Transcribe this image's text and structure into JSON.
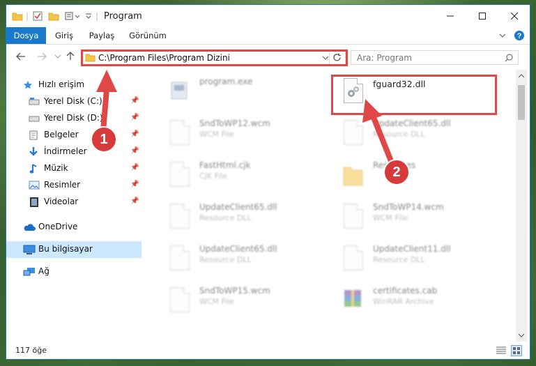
{
  "window": {
    "title": "Program"
  },
  "ribbon": {
    "tabs": [
      "Dosya",
      "Giriş",
      "Paylaş",
      "Görünüm"
    ]
  },
  "address": {
    "path": "C:\\Program Files\\Program Dizini"
  },
  "search": {
    "placeholder": "Ara: Program"
  },
  "nav": {
    "items": [
      {
        "label": "Hızlı erişim",
        "icon": "star-icon"
      },
      {
        "label": "Yerel Disk (C:)",
        "icon": "drive-icon"
      },
      {
        "label": "Yerel Disk (D:)",
        "icon": "drive-icon"
      },
      {
        "label": "Belgeler",
        "icon": "documents-icon"
      },
      {
        "label": "İndirmeler",
        "icon": "download-icon"
      },
      {
        "label": "Müzik",
        "icon": "music-icon"
      },
      {
        "label": "Resimler",
        "icon": "pictures-icon"
      },
      {
        "label": "Videolar",
        "icon": "video-icon"
      },
      {
        "label": "OneDrive",
        "icon": "cloud-icon"
      },
      {
        "label": "Bu bilgisayar",
        "icon": "computer-icon"
      },
      {
        "label": "Ağ",
        "icon": "network-icon"
      }
    ]
  },
  "files": [
    {
      "name": "program.exe",
      "type": "",
      "icon": "exe-icon"
    },
    {
      "name": "fguard32.dll",
      "type": "",
      "icon": "dll-icon"
    },
    {
      "name": "SndToWP12.wcm",
      "type": "WCM File",
      "icon": "file-icon"
    },
    {
      "name": "UpdateClient65.dll",
      "type": "Resource DLL",
      "icon": "dll-icon"
    },
    {
      "name": "FastHtml.cjk",
      "type": "CJK File",
      "icon": "file-icon"
    },
    {
      "name": "Resources",
      "type": "",
      "icon": "folder-icon"
    },
    {
      "name": "UpdateClient65.dll",
      "type": "Resource DLL",
      "icon": "dll-icon"
    },
    {
      "name": "SndToWP14.wcm",
      "type": "WCM File",
      "icon": "file-icon"
    },
    {
      "name": "UpdateClient65.dll",
      "type": "Resource DLL",
      "icon": "dll-icon"
    },
    {
      "name": "UpdateClient11.dll",
      "type": "Resource DLL",
      "icon": "dll-icon"
    },
    {
      "name": "SndToWP15.wcm",
      "type": "WCM File",
      "icon": "file-icon"
    },
    {
      "name": "certificates.cab",
      "type": "WinRAR Archive",
      "icon": "archive-icon"
    }
  ],
  "status": {
    "count": "117 öğe"
  },
  "annotations": {
    "badge1": "1",
    "badge2": "2"
  },
  "colors": {
    "accent": "#1979ca",
    "highlight": "#e04848"
  }
}
